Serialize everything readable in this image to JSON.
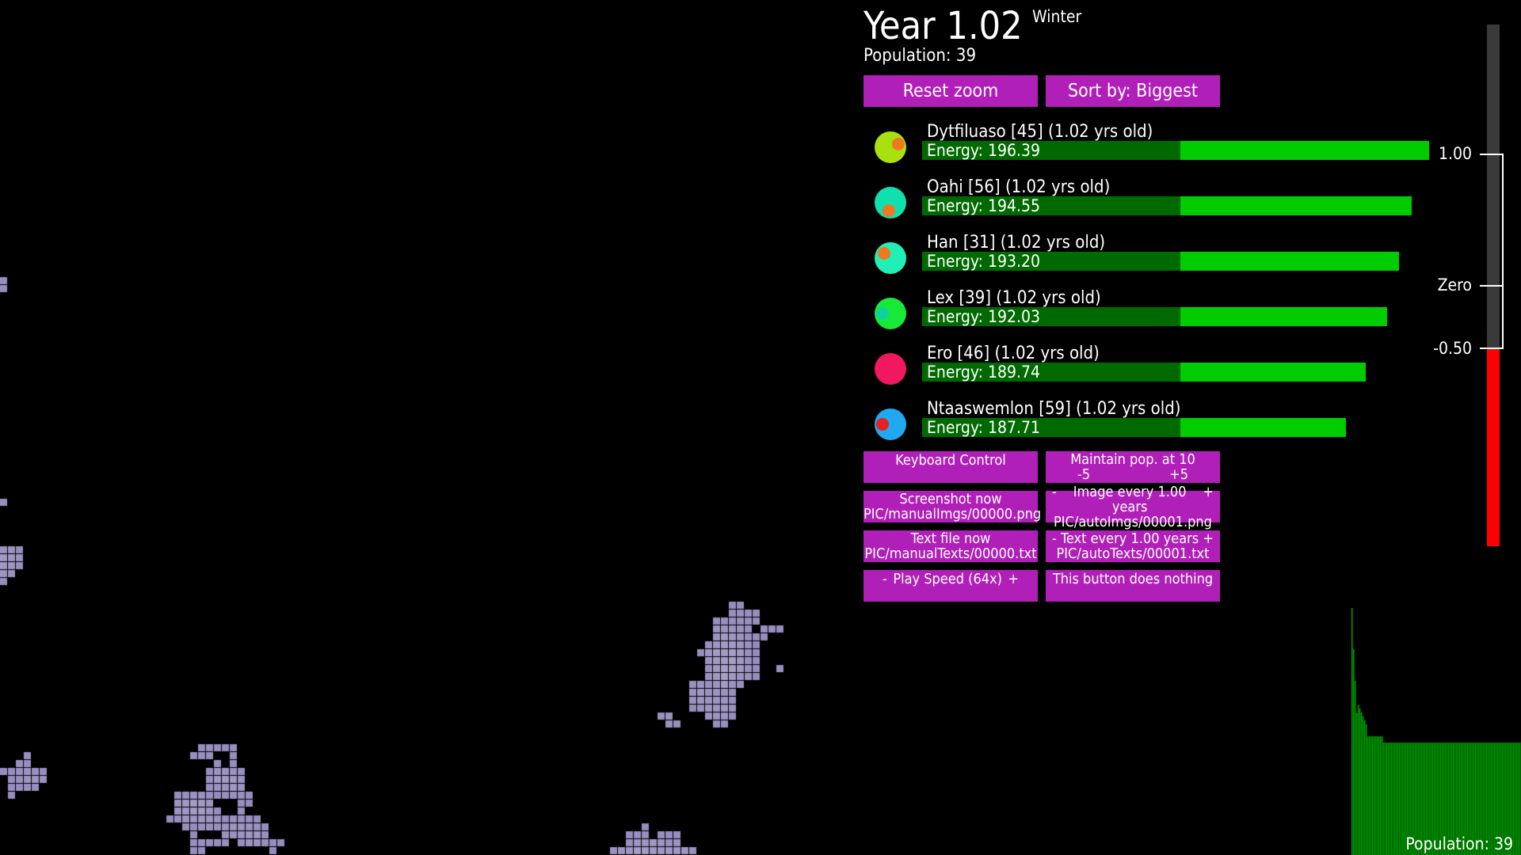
{
  "header": {
    "year": "Year 1.02",
    "season": "Winter",
    "population": "Population: 39"
  },
  "buttons": {
    "reset_zoom": "Reset zoom",
    "sort_by": "Sort by: Biggest",
    "keyboard_control": "Keyboard Control",
    "maintain_pop_line1": "Maintain pop. at 10",
    "maintain_pop_minus": "-5",
    "maintain_pop_plus": "+5",
    "screenshot_line1": "Screenshot now",
    "screenshot_line2": "PIC/manualImgs/00000.png",
    "image_every_minus": "-",
    "image_every_label": "Image every 1.00 years",
    "image_every_plus": "+",
    "image_every_line2": "PIC/autoImgs/00001.png",
    "text_file_line1": "Text file now",
    "text_file_line2": "PIC/manualTexts/00000.txt",
    "text_every_minus": "-",
    "text_every_label": "Text every 1.00 years",
    "text_every_plus": "+",
    "text_every_line2": "PIC/autoTexts/00001.txt",
    "speed_minus": "-",
    "speed_label": "Play Speed (64x)",
    "speed_plus": "+",
    "nothing": "This button does nothing"
  },
  "creatures": [
    {
      "name": "Dytfiluaso [45] (1.02 yrs old)",
      "energy_label": "Energy: 196.39",
      "energy": 196.39,
      "color": "#a8e010",
      "spot": "#f07820"
    },
    {
      "name": "Oahi [56] (1.02 yrs old)",
      "energy_label": "Energy: 194.55",
      "energy": 194.55,
      "color": "#10e0b0",
      "spot": "#f07820"
    },
    {
      "name": "Han [31] (1.02 yrs old)",
      "energy_label": "Energy: 193.20",
      "energy": 193.2,
      "color": "#20f0b8",
      "spot": "#f07820"
    },
    {
      "name": "Lex [39] (1.02 yrs old)",
      "energy_label": "Energy: 192.03",
      "energy": 192.03,
      "color": "#18e838",
      "spot": "#10d0a0"
    },
    {
      "name": "Ero [46] (1.02 yrs old)",
      "energy_label": "Energy: 189.74",
      "energy": 189.74,
      "color": "#f01860",
      "spot": "#f01860"
    },
    {
      "name": "Ntaaswemlon [59] (1.02 yrs old)",
      "energy_label": "Energy: 187.71",
      "energy": 187.71,
      "color": "#20a8f0",
      "spot": "#e82020"
    }
  ],
  "scale": {
    "top_label": "1.00",
    "zero_label": "Zero",
    "value_label": "-0.50",
    "value": -0.5
  },
  "footer": {
    "population": "Population: 39"
  },
  "colors": {
    "button": "#b020b8",
    "energy_bright": "#00cc00",
    "energy_dark": "#006a00",
    "scale_negative": "#ff0000",
    "histogram": "#00b000"
  }
}
